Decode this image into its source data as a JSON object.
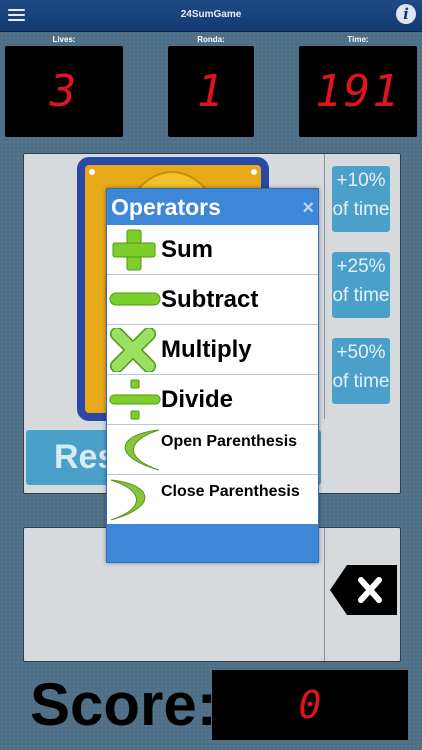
{
  "header": {
    "title": "24SumGame",
    "menu_icon": "menu-icon",
    "info_label": "i"
  },
  "stats": {
    "lives_label": "Lives:",
    "lives_value": "3",
    "round_label": "Ronda:",
    "round_value": "1",
    "time_label": "Time:",
    "time_value": "191"
  },
  "time_bonus": {
    "plus10": [
      "+10%",
      "of time"
    ],
    "plus25": [
      "+25%",
      "of time"
    ],
    "plus50": [
      "+50%",
      "of time"
    ]
  },
  "restart_label": "Rest",
  "score": {
    "label": "Score:",
    "value": "0"
  },
  "popup": {
    "title": "Operators",
    "close_label": "×",
    "items": [
      {
        "label": "Sum",
        "icon": "plus-icon"
      },
      {
        "label": "Subtract",
        "icon": "minus-icon"
      },
      {
        "label": "Multiply",
        "icon": "multiply-icon"
      },
      {
        "label": "Divide",
        "icon": "divide-icon"
      },
      {
        "label": "Open Parenthesis",
        "icon": "open-parenthesis-icon"
      },
      {
        "label": "Close Parenthesis",
        "icon": "close-parenthesis-icon"
      }
    ]
  },
  "colors": {
    "accent": "#3e86d6",
    "button": "#4aa0c9",
    "led": "#e0141c",
    "icon_green": "#7ccf2a"
  }
}
